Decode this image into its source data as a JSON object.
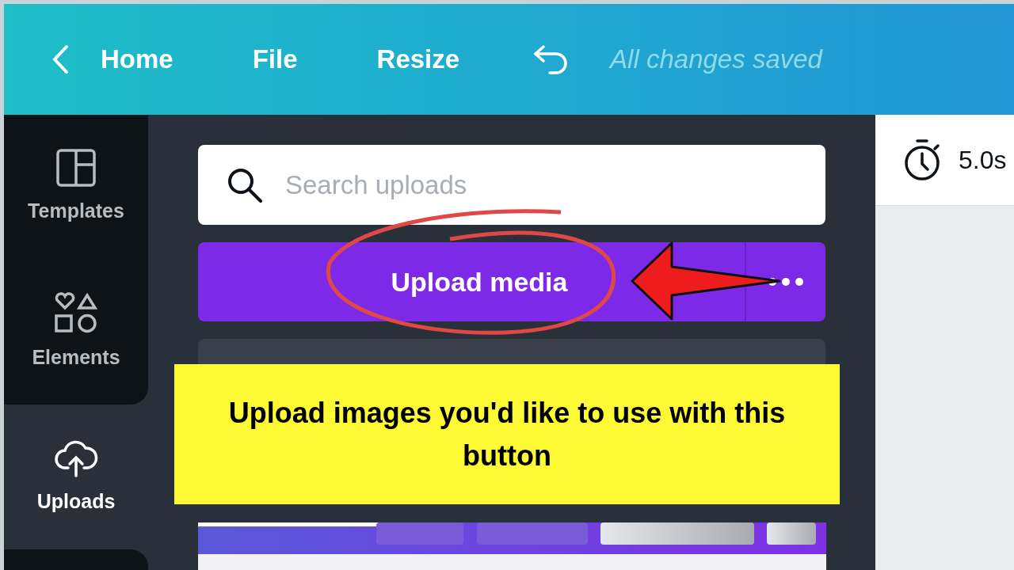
{
  "topbar": {
    "nav": [
      {
        "kind": "back",
        "label": "Home"
      },
      {
        "kind": "menu",
        "label": "File"
      },
      {
        "kind": "menu",
        "label": "Resize"
      }
    ],
    "status": "All changes saved"
  },
  "sidebar": {
    "items": [
      {
        "kind": "templates",
        "label": "Templates",
        "selected": false
      },
      {
        "kind": "elements",
        "label": "Elements",
        "selected": false
      },
      {
        "kind": "uploads",
        "label": "Uploads",
        "selected": true
      }
    ]
  },
  "panel": {
    "search": {
      "placeholder": "Search uploads"
    },
    "upload_button": {
      "label": "Upload media"
    }
  },
  "annotation": {
    "text": "Upload images you'd like to use with this button"
  },
  "editor": {
    "duration": "5.0s"
  }
}
